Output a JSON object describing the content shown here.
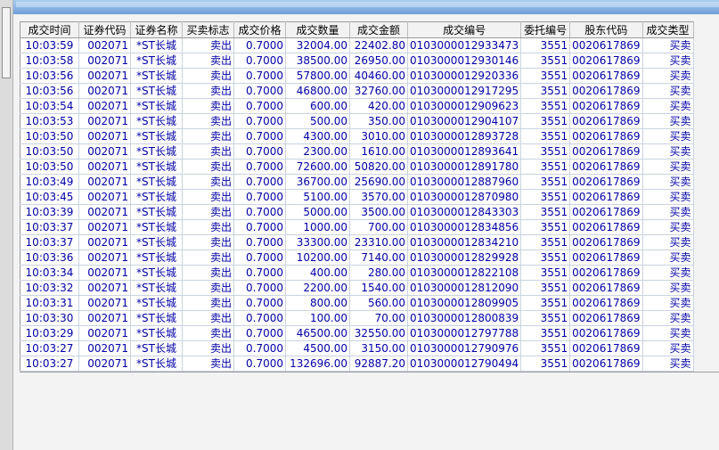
{
  "table": {
    "headers": [
      "成交时间",
      "证券代码",
      "证券名称",
      "买卖标志",
      "成交价格",
      "成交数量",
      "成交金额",
      "成交编号",
      "委托编号",
      "股东代码",
      "成交类型"
    ],
    "rows": [
      [
        "10:03:59",
        "002071",
        "*ST长城",
        "卖出",
        "0.7000",
        "32004.00",
        "22402.80",
        "0103000012933473",
        "3551",
        "0020617869",
        "买卖"
      ],
      [
        "10:03:58",
        "002071",
        "*ST长城",
        "卖出",
        "0.7000",
        "38500.00",
        "26950.00",
        "0103000012930146",
        "3551",
        "0020617869",
        "买卖"
      ],
      [
        "10:03:56",
        "002071",
        "*ST长城",
        "卖出",
        "0.7000",
        "57800.00",
        "40460.00",
        "0103000012920336",
        "3551",
        "0020617869",
        "买卖"
      ],
      [
        "10:03:56",
        "002071",
        "*ST长城",
        "卖出",
        "0.7000",
        "46800.00",
        "32760.00",
        "0103000012917295",
        "3551",
        "0020617869",
        "买卖"
      ],
      [
        "10:03:54",
        "002071",
        "*ST长城",
        "卖出",
        "0.7000",
        "600.00",
        "420.00",
        "0103000012909623",
        "3551",
        "0020617869",
        "买卖"
      ],
      [
        "10:03:53",
        "002071",
        "*ST长城",
        "卖出",
        "0.7000",
        "500.00",
        "350.00",
        "0103000012904107",
        "3551",
        "0020617869",
        "买卖"
      ],
      [
        "10:03:50",
        "002071",
        "*ST长城",
        "卖出",
        "0.7000",
        "4300.00",
        "3010.00",
        "0103000012893728",
        "3551",
        "0020617869",
        "买卖"
      ],
      [
        "10:03:50",
        "002071",
        "*ST长城",
        "卖出",
        "0.7000",
        "2300.00",
        "1610.00",
        "0103000012893641",
        "3551",
        "0020617869",
        "买卖"
      ],
      [
        "10:03:50",
        "002071",
        "*ST长城",
        "卖出",
        "0.7000",
        "72600.00",
        "50820.00",
        "0103000012891780",
        "3551",
        "0020617869",
        "买卖"
      ],
      [
        "10:03:49",
        "002071",
        "*ST长城",
        "卖出",
        "0.7000",
        "36700.00",
        "25690.00",
        "0103000012887960",
        "3551",
        "0020617869",
        "买卖"
      ],
      [
        "10:03:45",
        "002071",
        "*ST长城",
        "卖出",
        "0.7000",
        "5100.00",
        "3570.00",
        "0103000012870980",
        "3551",
        "0020617869",
        "买卖"
      ],
      [
        "10:03:39",
        "002071",
        "*ST长城",
        "卖出",
        "0.7000",
        "5000.00",
        "3500.00",
        "0103000012843303",
        "3551",
        "0020617869",
        "买卖"
      ],
      [
        "10:03:37",
        "002071",
        "*ST长城",
        "卖出",
        "0.7000",
        "1000.00",
        "700.00",
        "0103000012834856",
        "3551",
        "0020617869",
        "买卖"
      ],
      [
        "10:03:37",
        "002071",
        "*ST长城",
        "卖出",
        "0.7000",
        "33300.00",
        "23310.00",
        "0103000012834210",
        "3551",
        "0020617869",
        "买卖"
      ],
      [
        "10:03:36",
        "002071",
        "*ST长城",
        "卖出",
        "0.7000",
        "10200.00",
        "7140.00",
        "0103000012829928",
        "3551",
        "0020617869",
        "买卖"
      ],
      [
        "10:03:34",
        "002071",
        "*ST长城",
        "卖出",
        "0.7000",
        "400.00",
        "280.00",
        "0103000012822108",
        "3551",
        "0020617869",
        "买卖"
      ],
      [
        "10:03:32",
        "002071",
        "*ST长城",
        "卖出",
        "0.7000",
        "2200.00",
        "1540.00",
        "0103000012812090",
        "3551",
        "0020617869",
        "买卖"
      ],
      [
        "10:03:31",
        "002071",
        "*ST长城",
        "卖出",
        "0.7000",
        "800.00",
        "560.00",
        "0103000012809905",
        "3551",
        "0020617869",
        "买卖"
      ],
      [
        "10:03:30",
        "002071",
        "*ST长城",
        "卖出",
        "0.7000",
        "100.00",
        "70.00",
        "0103000012800839",
        "3551",
        "0020617869",
        "买卖"
      ],
      [
        "10:03:29",
        "002071",
        "*ST长城",
        "卖出",
        "0.7000",
        "46500.00",
        "32550.00",
        "0103000012797788",
        "3551",
        "0020617869",
        "买卖"
      ],
      [
        "10:03:27",
        "002071",
        "*ST长城",
        "卖出",
        "0.7000",
        "4500.00",
        "3150.00",
        "0103000012790976",
        "3551",
        "0020617869",
        "买卖"
      ],
      [
        "10:03:27",
        "002071",
        "*ST长城",
        "卖出",
        "0.7000",
        "132696.00",
        "92887.20",
        "0103000012790494",
        "3551",
        "0020617869",
        "买卖"
      ]
    ]
  }
}
